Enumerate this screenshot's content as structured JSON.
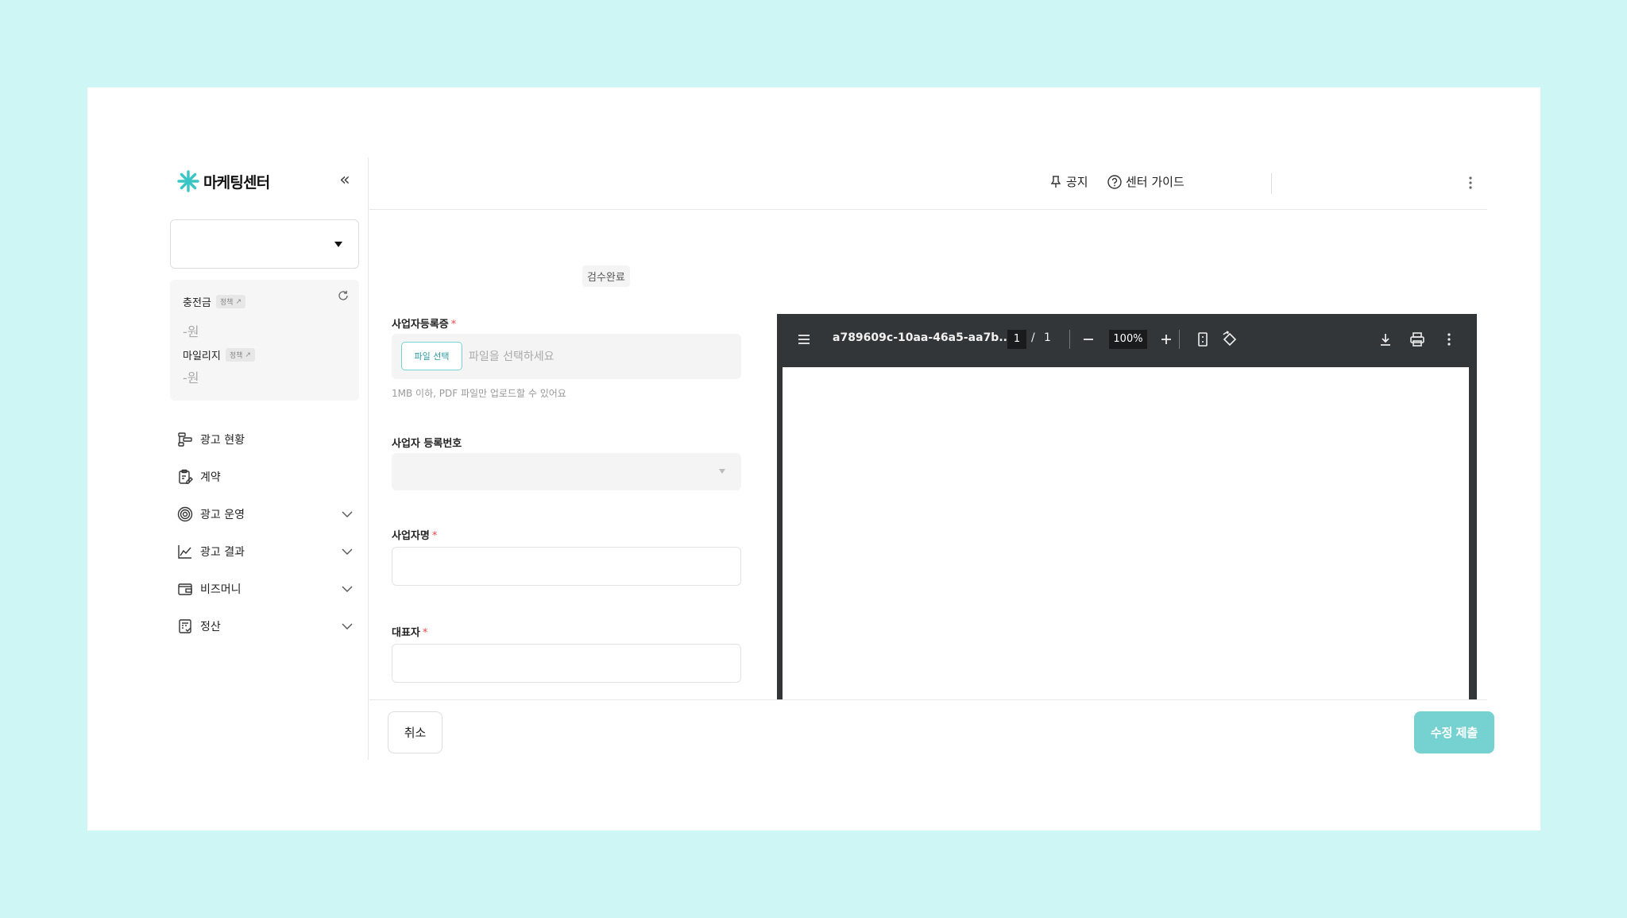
{
  "brand": {
    "name": "마케팅센터",
    "accent": "#38c5c4"
  },
  "sidebar": {
    "balance": {
      "charge_label": "충전금",
      "charge_tag": "정책",
      "charge_value": "-원",
      "mileage_label": "마일리지",
      "mileage_tag": "정책",
      "mileage_value": "-원"
    },
    "items": [
      {
        "label": "광고 현황",
        "icon": "ad-status-icon"
      },
      {
        "label": "계약",
        "icon": "contract-icon"
      },
      {
        "label": "광고 운영",
        "icon": "target-icon"
      },
      {
        "label": "광고 결과",
        "icon": "chart-line-icon"
      },
      {
        "label": "비즈머니",
        "icon": "wallet-icon"
      },
      {
        "label": "정산",
        "icon": "settlement-icon"
      }
    ]
  },
  "header": {
    "notice": "공지",
    "guide": "센터 가이드"
  },
  "form": {
    "status": "검수완료",
    "biz_cert_label": "사업자등록증",
    "file_button": "파일 선택",
    "file_placeholder": "파일을 선택하세요",
    "file_hint": "1MB 이하, PDF 파일만 업로드할 수 있어요",
    "biz_number_label": "사업자 등록번호",
    "biz_name_label": "사업자명",
    "ceo_label": "대표자",
    "required_mark": "*"
  },
  "pdf": {
    "filename": "a789609c-10aa-46a5-aa7b...",
    "page_current": "1",
    "page_separator": "/",
    "page_total": "1",
    "zoom": "100%"
  },
  "footer": {
    "cancel": "취소",
    "submit": "수정 제출"
  }
}
